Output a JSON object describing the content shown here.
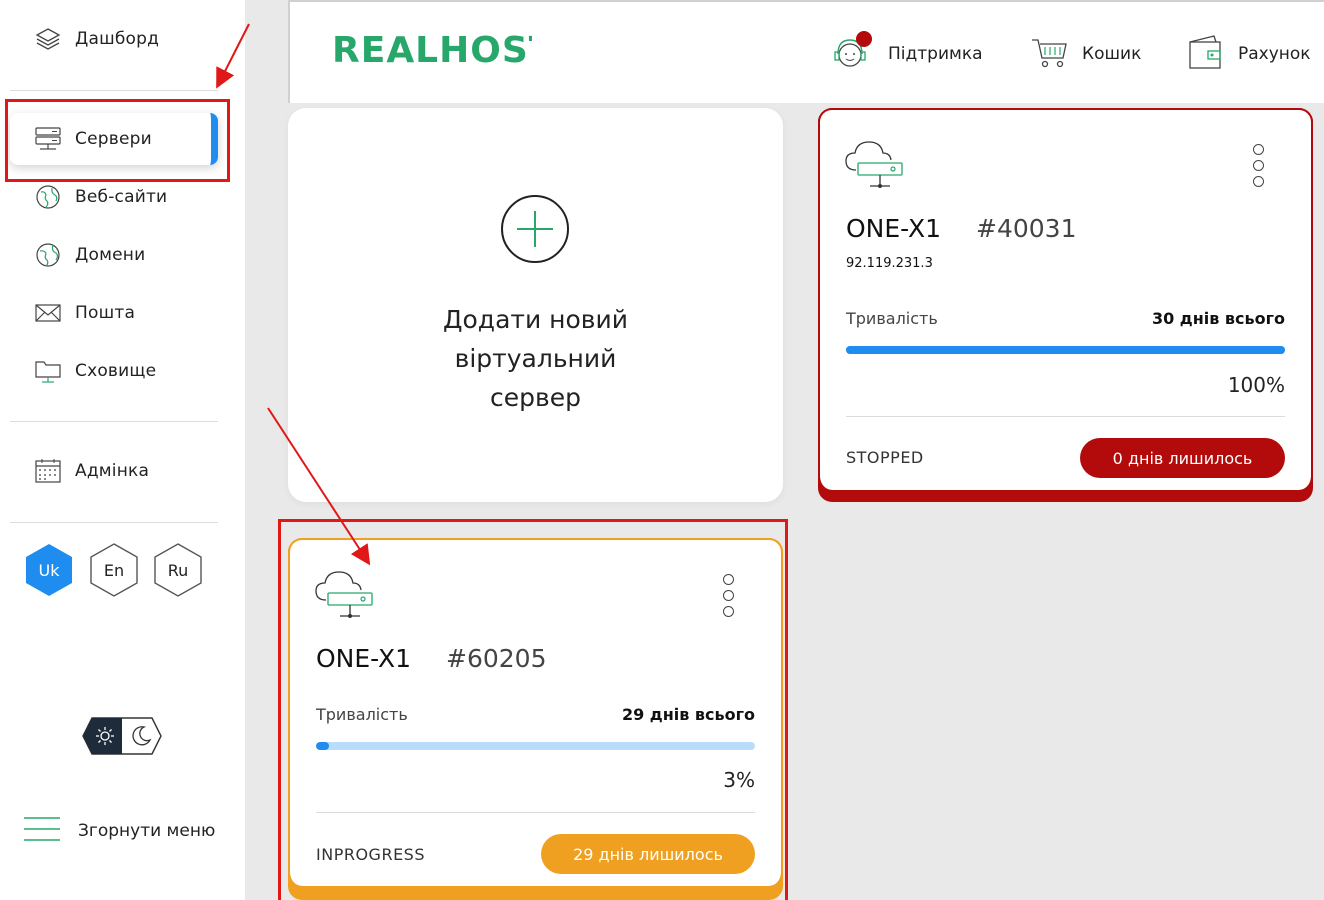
{
  "sidebar": {
    "items": [
      {
        "label": "Дашборд",
        "icon": "layers-icon"
      },
      {
        "label": "Сервери",
        "icon": "server-icon"
      },
      {
        "label": "Веб-сайти",
        "icon": "globe-icon"
      },
      {
        "label": "Домени",
        "icon": "globe-icon"
      },
      {
        "label": "Пошта",
        "icon": "mail-icon"
      },
      {
        "label": "Сховище",
        "icon": "folder-icon"
      },
      {
        "label": "Адмінка",
        "icon": "calendar-icon"
      }
    ],
    "languages": [
      "Uk",
      "En",
      "Ru"
    ],
    "collapse_label": "Згорнути меню"
  },
  "header": {
    "logo": "REALHOST",
    "support": "Підтримка",
    "cart": "Кошик",
    "account": "Рахунок"
  },
  "add_card": {
    "line1": "Додати новий",
    "line2": "віртуальний",
    "line3": "сервер"
  },
  "servers": [
    {
      "plan": "ONE-X1",
      "id": "#40031",
      "ip": "92.119.231.3",
      "duration_label": "Тривалість",
      "duration_total": "30 днів всього",
      "progress": 1.0,
      "percent": "100%",
      "status": "STOPPED",
      "remaining": "0 днів лишилось",
      "accent": "#b30b0b",
      "bar_fill": "#1f8cf0",
      "bar_track": "#1f8cf0"
    },
    {
      "plan": "ONE-X1",
      "id": "#60205",
      "duration_label": "Тривалість",
      "duration_total": "29 днів всього",
      "progress": 0.03,
      "percent": "3%",
      "status": "INPROGRESS",
      "remaining": "29 днів лишилось",
      "accent": "#f0a020",
      "bar_fill": "#1f8cf0",
      "bar_track": "#b8dcfa"
    }
  ]
}
